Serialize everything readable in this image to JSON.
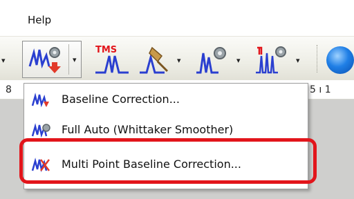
{
  "menubar": {
    "help_label": "Help"
  },
  "toolbar": {
    "buttons": [
      {
        "name": "baseline-correction-split-button",
        "icon": "baseline-correction-icon"
      },
      {
        "name": "tms-button",
        "icon": "tms-icon"
      },
      {
        "name": "peak-tool-button",
        "icon": "peak-tool-icon"
      },
      {
        "name": "peak-settings-button",
        "icon": "peak-settings-icon"
      },
      {
        "name": "multiplet-button",
        "icon": "multiplet-icon"
      }
    ],
    "arrow_glyph": "▾",
    "tms_text": "TMS"
  },
  "ruler": {
    "left_text": "8",
    "right_text": "5 ı 1"
  },
  "dropdown": {
    "items": [
      {
        "label": "Baseline Correction...",
        "icon": "baseline-correction-icon"
      },
      {
        "label": "Full Auto (Whittaker Smoother)",
        "icon": "full-auto-icon"
      },
      {
        "label": "Multi Point Baseline Correction...",
        "icon": "multi-point-icon"
      }
    ]
  },
  "colors": {
    "highlight": "#e2151b",
    "spectrum_blue": "#2a3fd0",
    "accent_red": "#e23a2a"
  }
}
